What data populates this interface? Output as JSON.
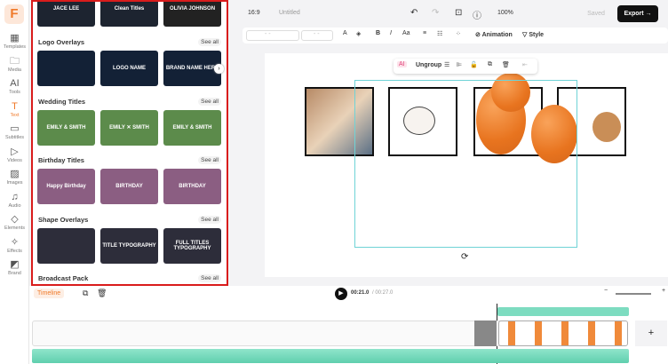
{
  "rail": {
    "logo": "F",
    "items": [
      {
        "label": "Templates",
        "icon": "templates-icon",
        "glyph": "▦"
      },
      {
        "label": "Media",
        "icon": "media-folder-icon",
        "glyph": "🗀"
      },
      {
        "label": "Tools",
        "icon": "ai-tools-icon",
        "glyph": "AI"
      },
      {
        "label": "Text",
        "icon": "text-icon",
        "glyph": "T"
      },
      {
        "label": "Subtitles",
        "icon": "subtitles-icon",
        "glyph": "▭"
      },
      {
        "label": "Videos",
        "icon": "videos-icon",
        "glyph": "▷"
      },
      {
        "label": "Images",
        "icon": "images-icon",
        "glyph": "▨"
      },
      {
        "label": "Audio",
        "icon": "audio-icon",
        "glyph": "♫"
      },
      {
        "label": "Elements",
        "icon": "elements-icon",
        "glyph": "◇"
      },
      {
        "label": "Effects",
        "icon": "effects-icon",
        "glyph": "✧"
      },
      {
        "label": "Brand",
        "icon": "brand-icon",
        "glyph": "◩"
      }
    ]
  },
  "panel": {
    "top_thumbs": [
      "JACE LEE",
      "Clean Titles",
      "OLIVIA JOHNSON"
    ],
    "sections": [
      {
        "title": "Logo Overlays",
        "see_all": "See all",
        "thumbs": [
          "",
          "LOGO NAME",
          "BRAND NAME HERE"
        ]
      },
      {
        "title": "Wedding Titles",
        "see_all": "See all",
        "thumbs": [
          "EMILY & SMITH",
          "EMILY ✕ SMITH",
          "EMILY & SMITH"
        ]
      },
      {
        "title": "Birthday Titles",
        "see_all": "See all",
        "thumbs": [
          "Happy Birthday",
          "BIRTHDAY",
          "BIRTHDAY"
        ]
      },
      {
        "title": "Shape Overlays",
        "see_all": "See all",
        "thumbs": [
          "",
          "TITLE TYPOGRAPHY",
          "FULL TITLES TYPOGRAPHY"
        ]
      },
      {
        "title": "Broadcast Pack",
        "see_all": "See all",
        "thumbs": []
      }
    ]
  },
  "topbar": {
    "aspect": "16:9",
    "title": "Untitled",
    "zoom": "100%",
    "saved": "Saved",
    "export": "Export →"
  },
  "format": {
    "font": "- -",
    "size": "- -",
    "animation": "Animation",
    "style": "Style"
  },
  "context": {
    "ai": "AI",
    "ungroup": "Ungroup"
  },
  "timeline": {
    "tab": "Timeline",
    "current": "00:21.0",
    "total": "/ 00:27.0",
    "add": "+"
  },
  "colors": {
    "accent": "#f07a2a",
    "selection": "#6fd3d6",
    "audio": "#7ddcc0",
    "highlight": "#d91c1c"
  }
}
